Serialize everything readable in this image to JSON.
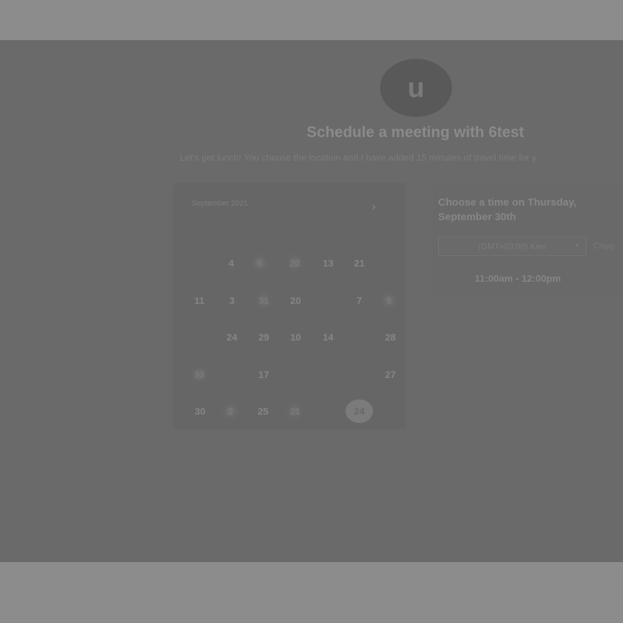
{
  "avatar": {
    "initial": "u"
  },
  "header": {
    "title": "Schedule a meeting with 6test",
    "subtitle": "Let's get lunch! You choose the location and I have added 15 minutes of travel time for y"
  },
  "calendar": {
    "month_label": "September 2021",
    "next_icon": "chevron-right-icon",
    "next_glyph": "›",
    "days": [
      {
        "label": "4",
        "state": "normal"
      },
      {
        "label": "5",
        "state": "blurred"
      },
      {
        "label": "22",
        "state": "blurred"
      },
      {
        "label": "13",
        "state": "normal"
      },
      {
        "label": "21",
        "state": "normal"
      },
      {
        "label": "11",
        "state": "normal"
      },
      {
        "label": "3",
        "state": "normal"
      },
      {
        "label": "31",
        "state": "blurred"
      },
      {
        "label": "20",
        "state": "normal"
      },
      {
        "label": "7",
        "state": "normal"
      },
      {
        "label": "9",
        "state": "blurred"
      },
      {
        "label": "24",
        "state": "normal"
      },
      {
        "label": "29",
        "state": "normal"
      },
      {
        "label": "10",
        "state": "normal"
      },
      {
        "label": "14",
        "state": "normal"
      },
      {
        "label": "28",
        "state": "normal"
      },
      {
        "label": "13",
        "state": "blurred"
      },
      {
        "label": "17",
        "state": "normal"
      },
      {
        "label": "27",
        "state": "normal"
      },
      {
        "label": "30",
        "state": "normal"
      },
      {
        "label": "2",
        "state": "blurred"
      },
      {
        "label": "25",
        "state": "normal"
      },
      {
        "label": "21",
        "state": "blurred"
      },
      {
        "label": "24",
        "state": "selected"
      }
    ]
  },
  "time_panel": {
    "heading": "Choose a time on Thursday, September 30th",
    "timezone": "(GMT+03:00) Kiev",
    "caret_glyph": "▾",
    "side_button": "Chipp",
    "slot": "11:00am - 12:00pm"
  }
}
